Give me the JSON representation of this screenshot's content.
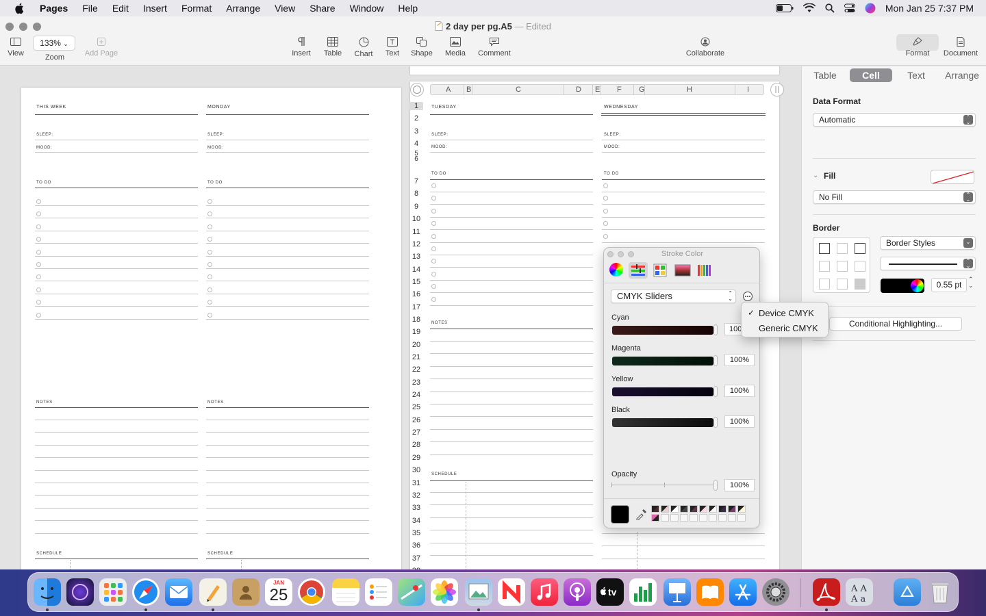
{
  "menubar": {
    "app": "Pages",
    "items": [
      "File",
      "Edit",
      "Insert",
      "Format",
      "Arrange",
      "View",
      "Share",
      "Window",
      "Help"
    ],
    "clock": "Mon Jan 25  7:37 PM"
  },
  "window": {
    "doc_title": "2 day per pg.A5",
    "edited": "Edited",
    "toolbar": {
      "view": "View",
      "zoom_value": "133%",
      "zoom": "Zoom",
      "add_page": "Add Page",
      "insert": "Insert",
      "table": "Table",
      "chart": "Chart",
      "text": "Text",
      "shape": "Shape",
      "media": "Media",
      "comment": "Comment",
      "collaborate": "Collaborate",
      "format": "Format",
      "document": "Document"
    }
  },
  "planner": {
    "this_week": "THIS WEEK",
    "monday": "MONDAY",
    "tuesday": "TUESDAY",
    "wednesday": "WEDNESDAY",
    "sleep": "SLEEP:",
    "mood": "MOOD:",
    "todo": "TO DO",
    "notes": "NOTES",
    "schedule": "SCHEDULE"
  },
  "table_header": {
    "columns": [
      "A",
      "B",
      "C",
      "D",
      "E",
      "F",
      "G",
      "H",
      "I"
    ],
    "rows": [
      "1",
      "2",
      "3",
      "4",
      "5",
      "6",
      "7",
      "8",
      "9",
      "10",
      "11",
      "12",
      "13",
      "14",
      "15",
      "16",
      "17",
      "18",
      "19",
      "20",
      "21",
      "22",
      "23",
      "24",
      "25",
      "26",
      "27",
      "28",
      "29",
      "30",
      "31",
      "32",
      "33",
      "34",
      "35",
      "36",
      "37",
      "38"
    ]
  },
  "inspector": {
    "tabs": [
      "Table",
      "Cell",
      "Text",
      "Arrange"
    ],
    "active_tab": "Cell",
    "data_format_label": "Data Format",
    "data_format_value": "Automatic",
    "fill_label": "Fill",
    "fill_value": "No Fill",
    "border_label": "Border",
    "border_styles": "Border Styles",
    "border_width": "0.55 pt",
    "conditional": "Conditional Highlighting..."
  },
  "color_panel": {
    "title": "Stroke Color",
    "mode": "CMYK Sliders",
    "sliders": [
      {
        "label": "Cyan",
        "value": "100"
      },
      {
        "label": "Magenta",
        "value": "100%"
      },
      {
        "label": "Yellow",
        "value": "100%"
      },
      {
        "label": "Black",
        "value": "100%"
      }
    ],
    "opacity_label": "Opacity",
    "opacity_value": "100%"
  },
  "profile_menu": {
    "items": [
      "Device CMYK",
      "Generic CMYK"
    ],
    "checked": "Device CMYK"
  },
  "dock": {
    "calendar_month": "JAN",
    "calendar_day": "25",
    "tv_label": "tv"
  },
  "colors": {
    "cyan_track": "#2a0a0a",
    "magenta_track": "#0a1f10",
    "yellow_track": "#0e0a1e",
    "black_track": "#151515"
  }
}
